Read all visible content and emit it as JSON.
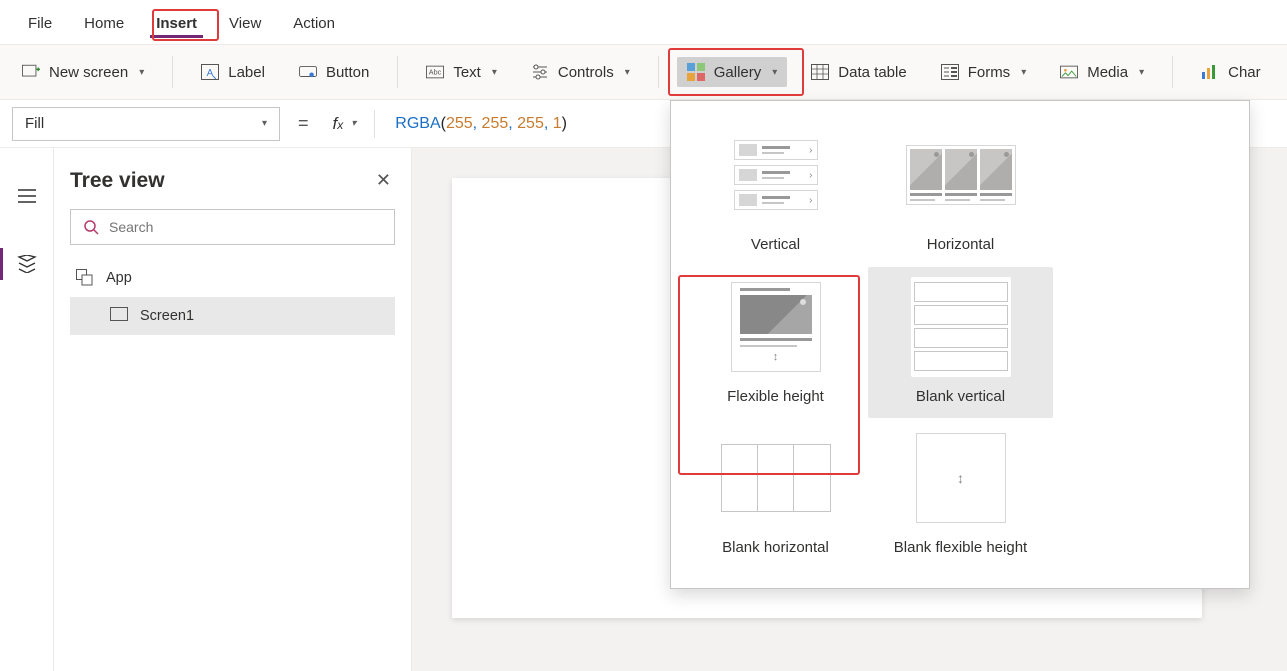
{
  "menu": {
    "file": "File",
    "home": "Home",
    "insert": "Insert",
    "view": "View",
    "action": "Action"
  },
  "ribbon": {
    "new_screen": "New screen",
    "label": "Label",
    "button": "Button",
    "text": "Text",
    "controls": "Controls",
    "gallery": "Gallery",
    "data_table": "Data table",
    "forms": "Forms",
    "media": "Media",
    "charts": "Char"
  },
  "formula": {
    "property": "Fill",
    "fn_name": "RGBA",
    "args": [
      "255",
      "255",
      "255",
      "1"
    ]
  },
  "tree": {
    "title": "Tree view",
    "search_placeholder": "Search",
    "app": "App",
    "screen1": "Screen1"
  },
  "gallery": {
    "vertical": "Vertical",
    "horizontal": "Horizontal",
    "flexible": "Flexible height",
    "blank_vertical": "Blank vertical",
    "blank_horizontal": "Blank horizontal",
    "blank_flexible": "Blank flexible height"
  }
}
